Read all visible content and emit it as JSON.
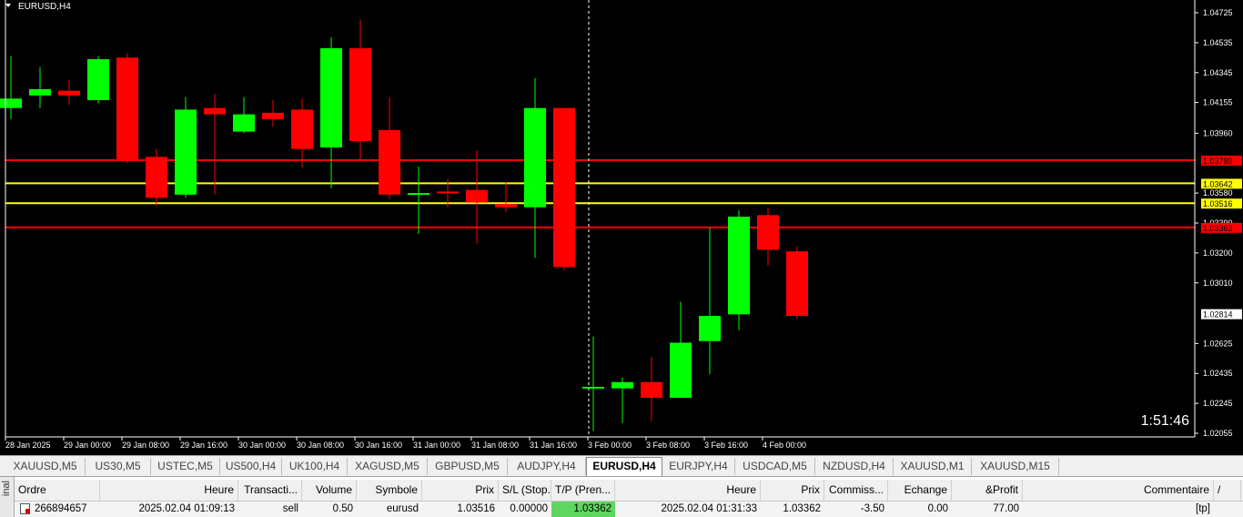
{
  "chart": {
    "symbol_label": "EURUSD,H4",
    "timer": "1:51:46",
    "colors": {
      "background": "#000000",
      "bull": "#00ff00",
      "bear": "#ff0000",
      "axis": "#ffffff",
      "grid_cursor": "#ffffff"
    },
    "price_levels": [
      "1.04725",
      "1.04535",
      "1.04345",
      "1.04155",
      "1.03960",
      "1.03580",
      "1.03390",
      "1.03200",
      "1.03010",
      "1.02625",
      "1.02435",
      "1.02245",
      "1.02055"
    ],
    "marked_prices": [
      {
        "value": "1.03789",
        "color": "#ff0000",
        "bg": "#ff0000",
        "fg": "#000000",
        "line": "red"
      },
      {
        "value": "1.03642",
        "color": "#ffff00",
        "bg": "#ffff00",
        "fg": "#000000",
        "line": "yellow"
      },
      {
        "value": "1.03516",
        "color": "#ffff00",
        "bg": "#ffff00",
        "fg": "#000000",
        "line": "yellow"
      },
      {
        "value": "1.03362",
        "color": "#ff0000",
        "bg": "#ff0000",
        "fg": "#000000",
        "line": "red"
      },
      {
        "value": "1.02814",
        "color": "#ffffff",
        "bg": "#ffffff",
        "fg": "#000000",
        "line": "none"
      }
    ],
    "time_labels": [
      "28 Jan 2025",
      "29 Jan 00:00",
      "29 Jan 08:00",
      "29 Jan 16:00",
      "30 Jan 00:00",
      "30 Jan 08:00",
      "30 Jan 16:00",
      "31 Jan 00:00",
      "31 Jan 08:00",
      "31 Jan 16:00",
      "3 Feb 00:00",
      "3 Feb 08:00",
      "3 Feb 16:00",
      "4 Feb 00:00"
    ]
  },
  "chart_data": {
    "type": "candlestick",
    "title": "EURUSD,H4",
    "ylim": [
      1.02,
      1.0479
    ],
    "candles": [
      {
        "o": 1.0412,
        "h": 1.0445,
        "l": 1.0405,
        "c": 1.0418
      },
      {
        "o": 1.042,
        "h": 1.0438,
        "l": 1.0412,
        "c": 1.0424
      },
      {
        "o": 1.0423,
        "h": 1.043,
        "l": 1.0414,
        "c": 1.042
      },
      {
        "o": 1.0417,
        "h": 1.0445,
        "l": 1.0415,
        "c": 1.0443
      },
      {
        "o": 1.0444,
        "h": 1.0447,
        "l": 1.0377,
        "c": 1.0379
      },
      {
        "o": 1.0381,
        "h": 1.0386,
        "l": 1.035,
        "c": 1.0355
      },
      {
        "o": 1.0357,
        "h": 1.0419,
        "l": 1.0355,
        "c": 1.0411
      },
      {
        "o": 1.0412,
        "h": 1.0421,
        "l": 1.0357,
        "c": 1.0408
      },
      {
        "o": 1.0397,
        "h": 1.0419,
        "l": 1.0396,
        "c": 1.0408
      },
      {
        "o": 1.0409,
        "h": 1.0417,
        "l": 1.04,
        "c": 1.0405
      },
      {
        "o": 1.0411,
        "h": 1.0418,
        "l": 1.0374,
        "c": 1.0386
      },
      {
        "o": 1.0387,
        "h": 1.0457,
        "l": 1.0361,
        "c": 1.045
      },
      {
        "o": 1.045,
        "h": 1.0468,
        "l": 1.0379,
        "c": 1.0391
      },
      {
        "o": 1.0398,
        "h": 1.0419,
        "l": 1.0354,
        "c": 1.0357
      },
      {
        "o": 1.0358,
        "h": 1.0375,
        "l": 1.0332,
        "c": 1.0358
      },
      {
        "o": 1.0359,
        "h": 1.0367,
        "l": 1.0349,
        "c": 1.0358
      },
      {
        "o": 1.036,
        "h": 1.0385,
        "l": 1.0326,
        "c": 1.0352
      },
      {
        "o": 1.0351,
        "h": 1.0365,
        "l": 1.0346,
        "c": 1.0349
      },
      {
        "o": 1.0349,
        "h": 1.0431,
        "l": 1.0317,
        "c": 1.0412
      },
      {
        "o": 1.0412,
        "h": 1.0412,
        "l": 1.0309,
        "c": 1.0311
      },
      {
        "o": 1.0235,
        "h": 1.0267,
        "l": 1.0207,
        "c": 1.0235
      },
      {
        "o": 1.0234,
        "h": 1.0241,
        "l": 1.0212,
        "c": 1.0238
      },
      {
        "o": 1.0238,
        "h": 1.0254,
        "l": 1.0213,
        "c": 1.0228
      },
      {
        "o": 1.0228,
        "h": 1.0289,
        "l": 1.0228,
        "c": 1.0263
      },
      {
        "o": 1.0264,
        "h": 1.0336,
        "l": 1.0243,
        "c": 1.028
      },
      {
        "o": 1.0281,
        "h": 1.0347,
        "l": 1.0271,
        "c": 1.0343
      },
      {
        "o": 1.0344,
        "h": 1.0349,
        "l": 1.0312,
        "c": 1.0322
      },
      {
        "o": 1.0321,
        "h": 1.0324,
        "l": 1.0278,
        "c": 1.028
      }
    ]
  },
  "tabs": [
    {
      "label": "XAUUSD,M5",
      "active": false
    },
    {
      "label": "US30,M5",
      "active": false
    },
    {
      "label": "USTEC,M5",
      "active": false
    },
    {
      "label": "US500,H4",
      "active": false
    },
    {
      "label": "UK100,H4",
      "active": false
    },
    {
      "label": "XAGUSD,M5",
      "active": false
    },
    {
      "label": "GBPUSD,M5",
      "active": false
    },
    {
      "label": "AUDJPY,H4",
      "active": false
    },
    {
      "label": "EURUSD,H4",
      "active": true
    },
    {
      "label": "EURJPY,H4",
      "active": false
    },
    {
      "label": "USDCAD,M5",
      "active": false
    },
    {
      "label": "NZDUSD,H4",
      "active": false
    },
    {
      "label": "XAUUSD,M1",
      "active": false
    },
    {
      "label": "XAUUSD,M15",
      "active": false
    }
  ],
  "terminal": {
    "side_label": "inal",
    "columns": [
      "Ordre",
      "Heure",
      "Transacti...",
      "Volume",
      "Symbole",
      "Prix",
      "S/L (Stop...",
      "T/P (Pren...",
      "Heure",
      "Prix",
      "Commiss...",
      "Echange",
      "&Profit",
      "Commentaire",
      "/"
    ],
    "row": [
      "266894657",
      "2025.02.04 01:09:13",
      "sell",
      "0.50",
      "eurusd",
      "1.03516",
      "0.00000",
      "1.03362",
      "2025.02.04 01:31:33",
      "1.03362",
      "-3.50",
      "0.00",
      "77.00",
      "[tp]"
    ]
  }
}
